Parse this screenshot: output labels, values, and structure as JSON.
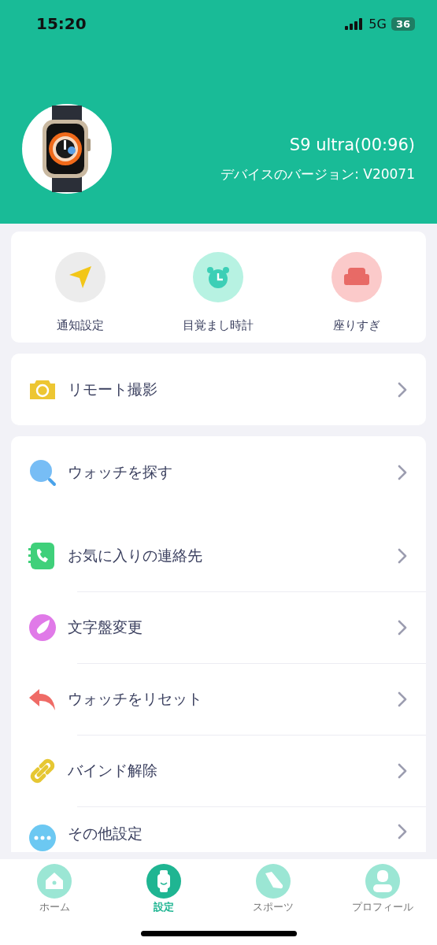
{
  "status_bar": {
    "time": "15:20",
    "network": "5G",
    "battery": "36"
  },
  "device": {
    "name": "S9 ultra(00:96)",
    "version": "デバイスのバージョン: V20071"
  },
  "quick_actions": [
    {
      "label": "通知設定",
      "kind": "arrow"
    },
    {
      "label": "目覚まし時計",
      "kind": "alarm"
    },
    {
      "label": "座りすぎ",
      "kind": "sofa"
    }
  ],
  "menu_groups": [
    {
      "items": [
        {
          "label": "リモート撮影",
          "kind": "camera"
        }
      ]
    },
    {
      "items": [
        {
          "label": "ウォッチを探す",
          "kind": "search"
        },
        {
          "label": "お気に入りの連絡先",
          "kind": "contacts"
        },
        {
          "label": "文字盤変更",
          "kind": "dial"
        },
        {
          "label": "ウォッチをリセット",
          "kind": "reset"
        },
        {
          "label": "バインド解除",
          "kind": "unbind"
        },
        {
          "label": "その他設定",
          "kind": "more"
        }
      ]
    }
  ],
  "tab_bar": [
    {
      "label": "ホーム",
      "kind": "home",
      "selected": false
    },
    {
      "label": "設定",
      "kind": "watch",
      "selected": true
    },
    {
      "label": "スポーツ",
      "kind": "shoe",
      "selected": false
    },
    {
      "label": "プロフィール",
      "kind": "profile",
      "selected": false
    }
  ]
}
